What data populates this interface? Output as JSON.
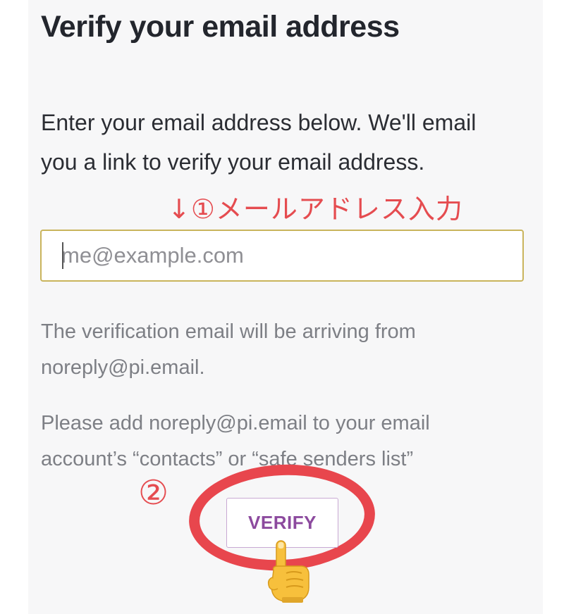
{
  "page": {
    "title": "Verify your email address",
    "intro": "Enter your email address below. We'll email you a link to verify your email address."
  },
  "form": {
    "email_placeholder": "me@example.com",
    "email_value": ""
  },
  "notes": {
    "sender": "The verification email will be arriving from noreply@pi.email.",
    "contacts": "Please add noreply@pi.email to your email account’s “contacts” or “safe senders list”"
  },
  "actions": {
    "verify_label": "VERIFY"
  },
  "annotations": {
    "step1": "↓①メールアドレス入力",
    "step2": "②",
    "accent_color": "#e54c50",
    "pointer_icon": "pointing-down-hand-icon"
  }
}
